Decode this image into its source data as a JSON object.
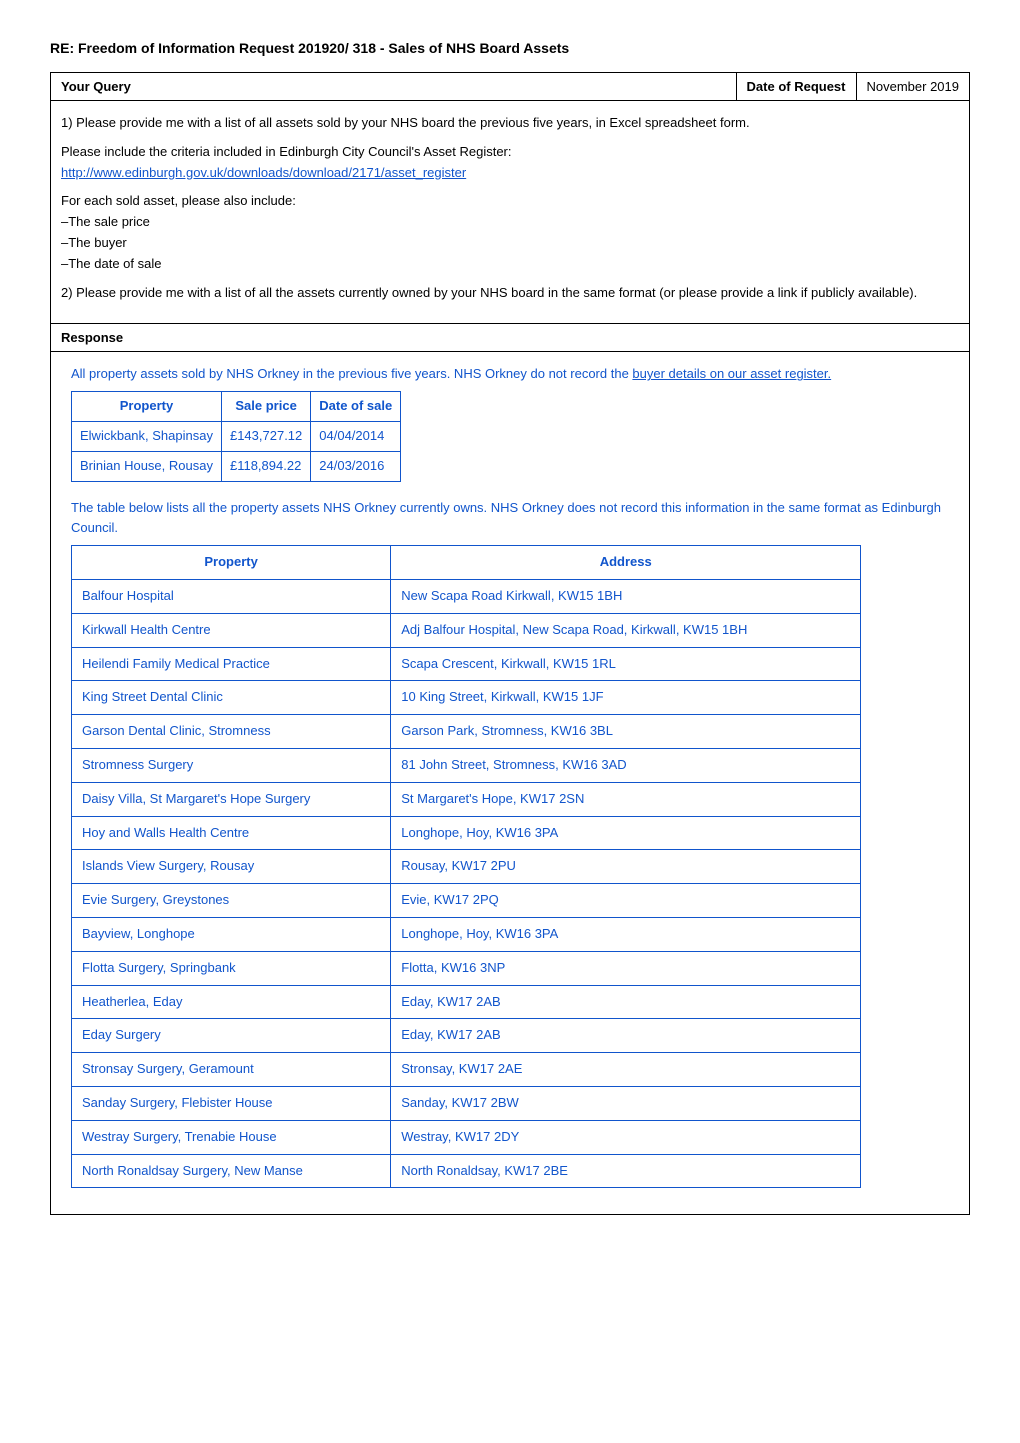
{
  "title": "RE: Freedom of Information Request 201920/ 318 - Sales of NHS Board Assets",
  "query_section": {
    "label": "Your Query",
    "date_label": "Date of Request",
    "date_value": "November 2019",
    "body_paragraphs": [
      "1) Please provide me with a list of all assets sold by your NHS board the previous five years, in Excel spreadsheet form.",
      "Please include the criteria included in Edinburgh City Council's Asset Register:",
      "",
      "",
      "For each sold asset, please also include:",
      "–The sale price",
      "–The buyer",
      "–The date of sale",
      "",
      "2) Please provide me with a list of all the assets currently owned by your NHS board in the same format (or please provide a link if publicly available)."
    ],
    "link_text": "http://www.edinburgh.gov.uk/downloads/download/2171/asset_register",
    "link_url": "http://www.edinburgh.gov.uk/downloads/download/2171/asset_register"
  },
  "response_section": {
    "label": "Response",
    "item1": {
      "intro": "All property assets sold by NHS Orkney in the previous five years. NHS Orkney do not record the buyer details on our asset register.",
      "intro_underline_start": 97,
      "table": {
        "headers": [
          "Property",
          "Sale price",
          "Date of sale"
        ],
        "rows": [
          [
            "Elwickbank, Shapinsay",
            "£143,727.12",
            "04/04/2014"
          ],
          [
            "Brinian House, Rousay",
            "£118,894.22",
            "24/03/2016"
          ]
        ]
      }
    },
    "item2": {
      "intro": "The table below lists all the property assets NHS Orkney currently owns. NHS Orkney does not record this information in the same format as Edinburgh Council.",
      "table": {
        "headers": [
          "Property",
          "Address"
        ],
        "rows": [
          [
            "Balfour Hospital",
            "New Scapa Road Kirkwall, KW15 1BH"
          ],
          [
            "Kirkwall Health Centre",
            "Adj Balfour Hospital, New Scapa Road, Kirkwall, KW15 1BH"
          ],
          [
            "Heilendi Family Medical Practice",
            "Scapa Crescent, Kirkwall, KW15 1RL"
          ],
          [
            "King Street Dental Clinic",
            "10 King Street, Kirkwall, KW15 1JF"
          ],
          [
            "Garson Dental Clinic, Stromness",
            "Garson Park, Stromness, KW16 3BL"
          ],
          [
            "Stromness Surgery",
            "81 John Street, Stromness, KW16 3AD"
          ],
          [
            "Daisy Villa, St Margaret's Hope Surgery",
            "St Margaret's Hope, KW17 2SN"
          ],
          [
            "Hoy and Walls Health Centre",
            "Longhope, Hoy, KW16 3PA"
          ],
          [
            "Islands View Surgery, Rousay",
            "Rousay, KW17 2PU"
          ],
          [
            "Evie Surgery, Greystones",
            "Evie, KW17 2PQ"
          ],
          [
            "Bayview, Longhope",
            "Longhope, Hoy, KW16 3PA"
          ],
          [
            "Flotta Surgery, Springbank",
            "Flotta, KW16 3NP"
          ],
          [
            "Heatherlea, Eday",
            "Eday, KW17 2AB"
          ],
          [
            "Eday Surgery",
            "Eday, KW17 2AB"
          ],
          [
            "Stronsay Surgery, Geramount",
            "Stronsay, KW17 2AE"
          ],
          [
            "Sanday Surgery, Flebister House",
            "Sanday, KW17 2BW"
          ],
          [
            "Westray Surgery, Trenabie House",
            "Westray, KW17 2DY"
          ],
          [
            "North Ronaldsay Surgery, New Manse",
            "North Ronaldsay, KW17 2BE"
          ]
        ]
      }
    }
  }
}
